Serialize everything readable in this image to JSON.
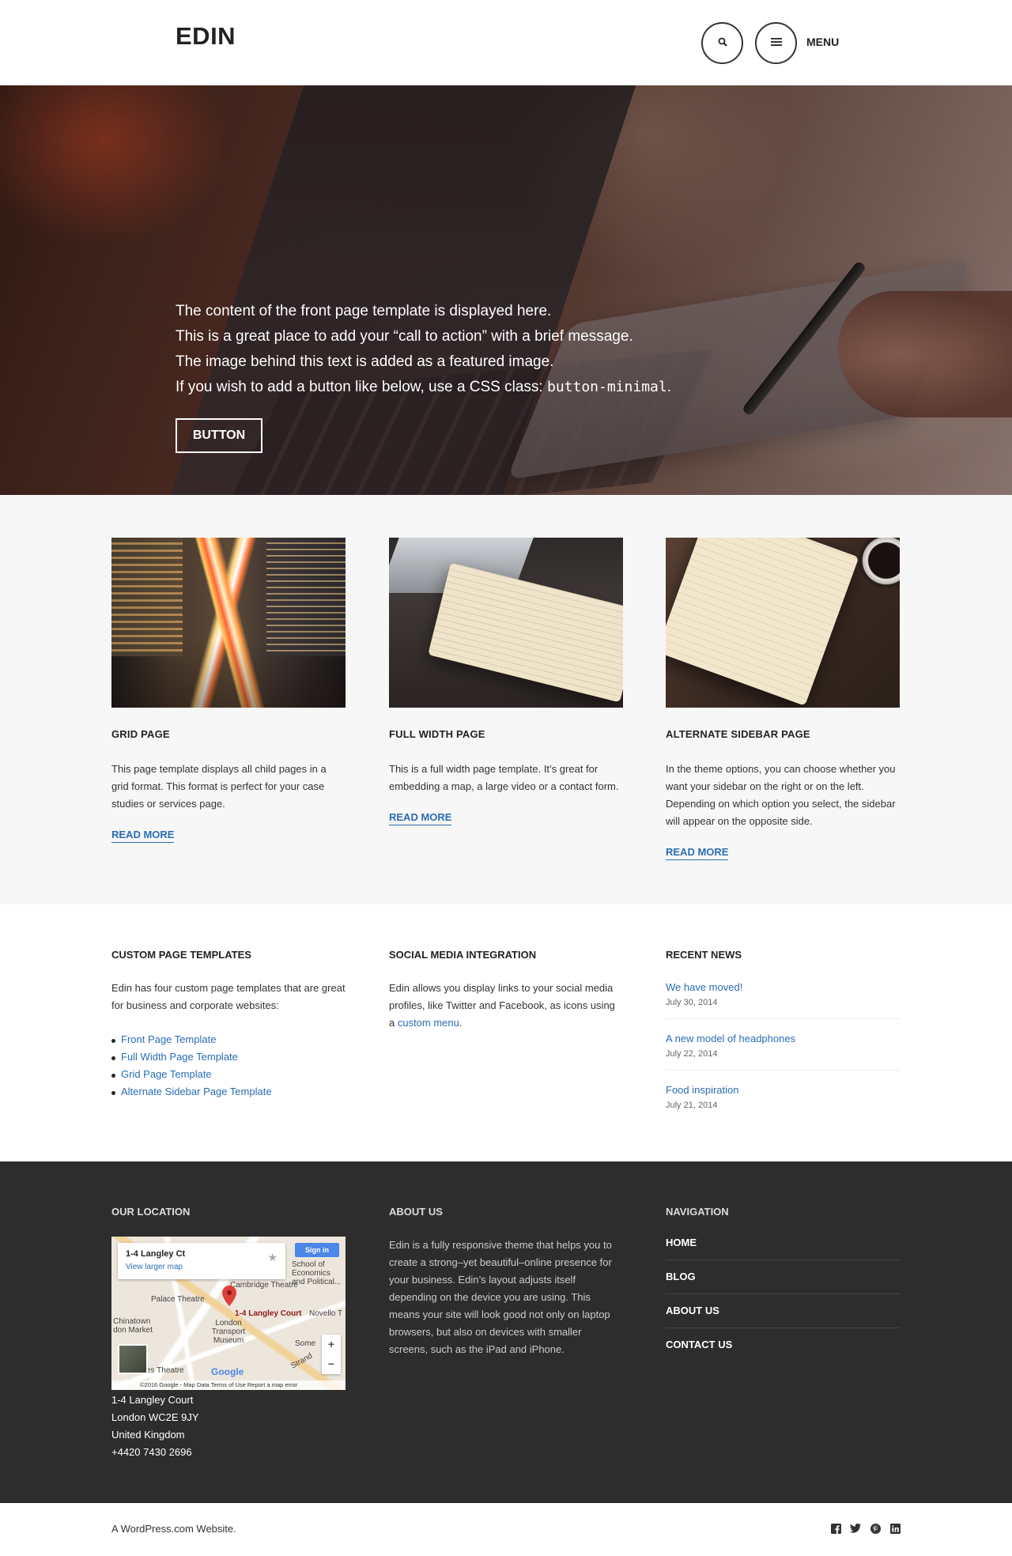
{
  "header": {
    "site_title": "EDIN",
    "menu_label": "MENU",
    "icons": [
      "search-icon",
      "hamburger-menu-icon"
    ]
  },
  "hero": {
    "lines": [
      "The content of the front page template is displayed here.",
      "This is a great place to add your “call to action” with a brief message.",
      "The image behind this text is added as a featured image."
    ],
    "line4_prefix": "If you wish to add a button like below, use a CSS class: ",
    "line4_code": "button-minimal",
    "line4_suffix": ".",
    "button_label": "BUTTON"
  },
  "featured_pages": [
    {
      "title": "GRID PAGE",
      "description": "This page template displays all child pages in a grid format. This format is perfect for your case studies or services page.",
      "link": "READ MORE"
    },
    {
      "title": "FULL WIDTH PAGE",
      "description": "This is a full width page template. It’s great for embedding a map, a large video or a contact form.",
      "link": "READ MORE"
    },
    {
      "title": "ALTERNATE SIDEBAR PAGE",
      "description": "In the theme options, you can choose whether you want your sidebar on the right or on the left. Depending on which option you select, the sidebar will appear on the opposite side.",
      "link": "READ MORE"
    }
  ],
  "widgets": {
    "custom_templates": {
      "title": "CUSTOM PAGE TEMPLATES",
      "text": "Edin has four custom page templates that are great for business and corporate websites:",
      "items": [
        "Front Page Template",
        "Full Width Page Template",
        "Grid Page Template",
        "Alternate Sidebar Page Template"
      ]
    },
    "social": {
      "title": "SOCIAL MEDIA INTEGRATION",
      "text_before": "Edin allows you display links to your social media profiles, like Twitter and Facebook, as icons using a ",
      "link": "custom menu",
      "text_after": "."
    },
    "recent_news": {
      "title": "RECENT NEWS",
      "items": [
        {
          "title": "We have moved!",
          "date": "July 30, 2014"
        },
        {
          "title": "A new model of headphones",
          "date": "July 22, 2014"
        },
        {
          "title": "Food inspiration",
          "date": "July 21, 2014"
        }
      ]
    }
  },
  "footer": {
    "location": {
      "title": "OUR LOCATION",
      "map": {
        "place_name": "1-4 Langley Ct",
        "larger_map": "View larger map",
        "sign_in": "Sign in",
        "labels": [
          "School of Economics and Political...",
          "Cambridge Theatre",
          "Palace Theatre",
          "1-4 Langley Court",
          "Novello T",
          "Chinatown",
          "don Market",
          "London Transport Museum",
          "Some",
          "es Theatre",
          "Strand"
        ],
        "logo": "Google",
        "footer_text": "©2016 Google - Map Data   Terms of Use   Report a map error",
        "zoom_in": "+",
        "zoom_out": "−"
      },
      "address_lines": [
        "1-4 Langley Court",
        "London WC2E 9JY",
        "United Kingdom",
        "+4420 7430 2696"
      ]
    },
    "about": {
      "title": "ABOUT US",
      "text": "Edin is a fully responsive theme that helps you to create a strong–yet beautiful–online presence for your business. Edin’s layout adjusts itself depending on the device you are using. This means your site will look good not only on laptop browsers, but also on devices with smaller screens, such as the iPad and iPhone."
    },
    "navigation": {
      "title": "NAVIGATION",
      "items": [
        "HOME",
        "BLOG",
        "ABOUT US",
        "CONTACT US"
      ]
    }
  },
  "bottom_bar": {
    "credit": "A WordPress.com Website.",
    "social_icons": [
      "facebook-icon",
      "twitter-icon",
      "pinterest-icon",
      "linkedin-icon"
    ]
  },
  "colors": {
    "link": "#2a6db3",
    "footer_bg": "#2d2d2d",
    "featured_bg": "#f7f7f7"
  }
}
